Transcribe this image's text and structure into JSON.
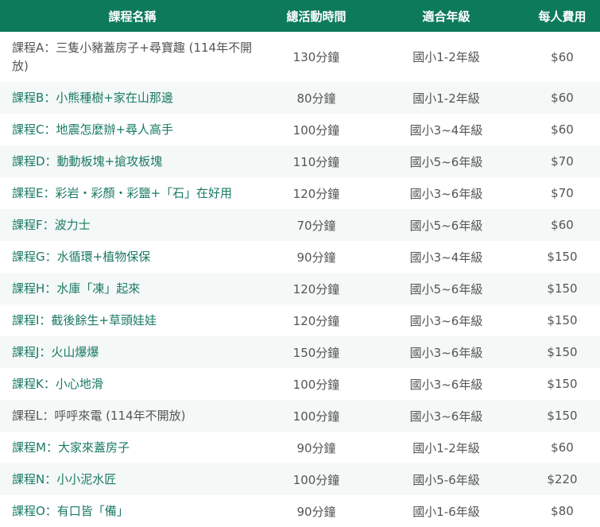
{
  "table": {
    "headers": [
      "課程名稱",
      "總活動時間",
      "適合年級",
      "每人費用"
    ],
    "rows": [
      {
        "name": "課程A：三隻小豬蓋房子+尋寶趣 (114年不開放)",
        "link": false,
        "duration": "130分鐘",
        "grade": "國小1-2年級",
        "fee": "$60"
      },
      {
        "name": "課程B：小熊種樹+家在山那邊",
        "link": true,
        "duration": "80分鐘",
        "grade": "國小1-2年級",
        "fee": "$60"
      },
      {
        "name": "課程C：地震怎麼辦+尋人高手",
        "link": true,
        "duration": "100分鐘",
        "grade": "國小3~4年級",
        "fee": "$60"
      },
      {
        "name": "課程D：動動板塊+搶攻板塊",
        "link": true,
        "duration": "110分鐘",
        "grade": "國小5~6年級",
        "fee": "$70"
      },
      {
        "name": "課程E：彩岩・彩顏・彩鹽+「石」在好用",
        "link": true,
        "duration": "120分鐘",
        "grade": "國小3~6年級",
        "fee": "$70"
      },
      {
        "name": "課程F：波力士",
        "link": true,
        "duration": "70分鐘",
        "grade": "國小5~6年級",
        "fee": "$60"
      },
      {
        "name": "課程G：水循環+植物保保",
        "link": true,
        "duration": "90分鐘",
        "grade": "國小3~4年級",
        "fee": "$150"
      },
      {
        "name": "課程H：水庫「凍」起來",
        "link": true,
        "duration": "120分鐘",
        "grade": "國小5~6年級",
        "fee": "$150"
      },
      {
        "name": "課程I：截後餘生+草頭娃娃",
        "link": true,
        "duration": "120分鐘",
        "grade": "國小3~6年級",
        "fee": "$150"
      },
      {
        "name": "課程J：火山爆爆",
        "link": true,
        "duration": "150分鐘",
        "grade": "國小3~6年級",
        "fee": "$150"
      },
      {
        "name": "課程K：小心地滑",
        "link": true,
        "duration": "100分鐘",
        "grade": "國小3~6年級",
        "fee": "$150"
      },
      {
        "name": "課程L：呼呼來電 (114年不開放)",
        "link": false,
        "duration": "100分鐘",
        "grade": "國小3~6年級",
        "fee": "$150"
      },
      {
        "name": "課程M：大家來蓋房子",
        "link": true,
        "duration": "90分鐘",
        "grade": "國小1-2年級",
        "fee": "$60"
      },
      {
        "name": "課程N：小小泥水匠",
        "link": true,
        "duration": "100分鐘",
        "grade": "國小5-6年級",
        "fee": "$220"
      },
      {
        "name": "課程O：有口皆「備」",
        "link": true,
        "duration": "90分鐘",
        "grade": "國小1-6年級",
        "fee": "$80"
      }
    ]
  },
  "colors": {
    "header_bg": "#0e7a5c",
    "link": "#1a7a63",
    "text": "#555555",
    "stripe": "#f4f8f7"
  }
}
